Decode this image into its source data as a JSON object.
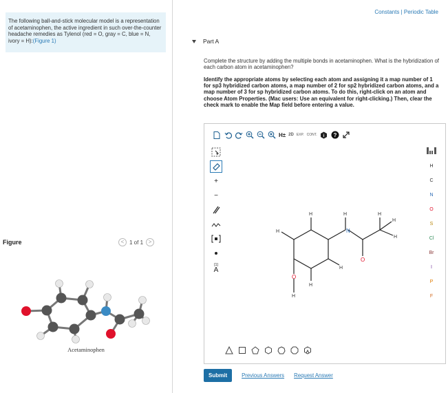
{
  "intro": {
    "text": "The following ball-and-stick molecular model is a representation of acetaminophen, the active ingredient in such over-the-counter headache remedies as Tylenol (red = O, gray = C, blue = N, ivory = H):",
    "figure_link": "(Figure 1)"
  },
  "figure": {
    "label": "Figure",
    "pager": {
      "prev": "<",
      "count": "1 of 1",
      "next": ">"
    },
    "caption": "Acetaminophen"
  },
  "header": {
    "links": [
      "Constants",
      "Periodic Table"
    ],
    "separator": "|"
  },
  "part": {
    "title": "Part A",
    "question": "Complete the structure by adding the multiple bonds in acetaminophen. What is the hybridization of each carbon atom in acetaminophen?",
    "instructions": "Identify the appropriate atoms by selecting each atom and assigning it a map number of 1 for sp3 hybridized carbon atoms, a map number of 2 for sp2 hybridized carbon atoms, and a map number of 3 for sp hybridized carbon atoms. To do this, right-click on an atom and choose Atom Properties. (Mac users: Use an equivalent for right-clicking.) Then, clear the check mark to enable the Map field before entering a value."
  },
  "editor": {
    "toolbar": [
      "new-icon",
      "undo-icon",
      "redo-icon",
      "zoom-in-icon",
      "zoom-out-icon",
      "zoom-reset-icon",
      "h-plus",
      "2d",
      "exp-cont",
      "info-icon",
      "help-icon",
      "expand-icon"
    ],
    "toolbar_text": {
      "h_plus": "H±",
      "two_d": "2D",
      "exp": "EXP.",
      "cont": "CONT."
    },
    "side_tools": [
      "select",
      "eraser",
      "plus-charge",
      "minus-charge",
      "bond",
      "chain",
      "template",
      "dot",
      "mapping"
    ],
    "side_text": {
      "plus": "+",
      "minus": "−",
      "atom_map": "A",
      "map_num": "[1]"
    },
    "elements": [
      "H",
      "C",
      "N",
      "O",
      "S",
      "Cl",
      "Br",
      "I",
      "P",
      "F"
    ],
    "molecule_labels": {
      "H": "H",
      "N": "N",
      "O": "O"
    },
    "shapes": [
      "triangle",
      "square",
      "pentagon",
      "hexagon",
      "heptagon",
      "octagon",
      "benzene"
    ]
  },
  "actions": {
    "submit": "Submit",
    "previous": "Previous Answers",
    "request": "Request Answer"
  },
  "colors": {
    "accent": "#1d6fa5",
    "intro_bg": "#e6f3f9",
    "oxygen": "#e0112b",
    "nitrogen": "#3b8bc4",
    "carbon": "#555555",
    "hydrogen": "#e8e8e8"
  }
}
